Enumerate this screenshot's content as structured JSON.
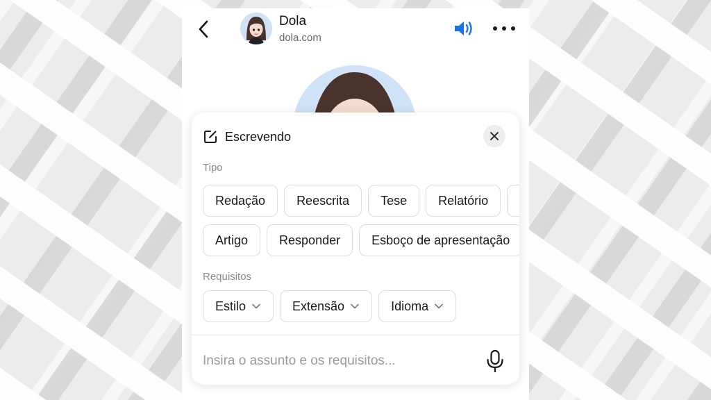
{
  "header": {
    "contact_name": "Dola",
    "contact_domain": "dola.com",
    "back_icon": "chevron-left-icon",
    "speaker_icon": "speaker-icon",
    "more_icon": "more-horizontal-icon",
    "accent_color": "#1a73e8"
  },
  "panel": {
    "title": "Escrevendo",
    "title_icon": "edit-icon",
    "close_icon": "close-icon",
    "type_section": {
      "label": "Tipo",
      "row1": [
        "Redação",
        "Reescrita",
        "Tese",
        "Relatório"
      ],
      "row2": [
        "Artigo",
        "Responder",
        "Esboço de apresentação"
      ]
    },
    "requirements_section": {
      "label": "Requisitos",
      "options": [
        "Estilo",
        "Extensão",
        "Idioma"
      ]
    },
    "input": {
      "placeholder": "Insira o assunto e os requisitos...",
      "value": ""
    },
    "mic_icon": "microphone-icon"
  }
}
